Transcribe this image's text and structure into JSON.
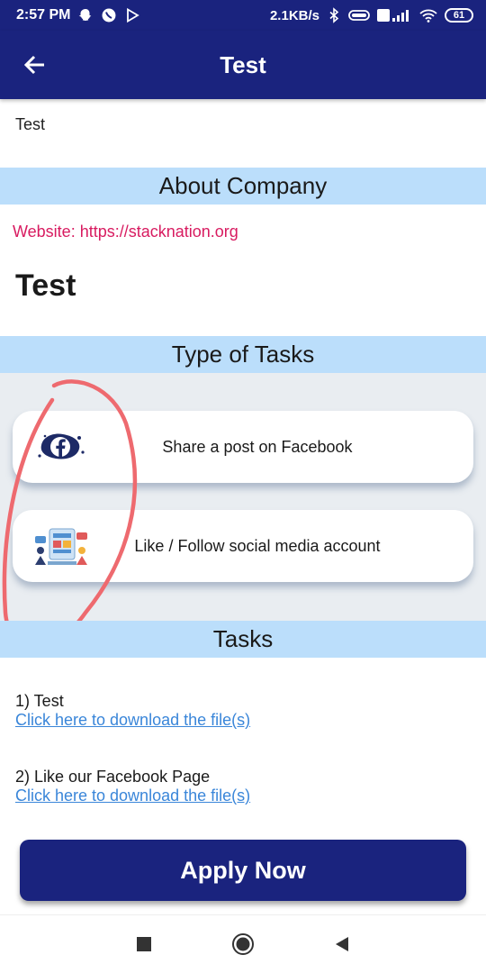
{
  "status_bar": {
    "time": "2:57 PM",
    "network_speed": "2.1KB/s",
    "battery": "61",
    "icons": [
      "snapchat-icon",
      "whatsapp-icon",
      "play-icon",
      "bluetooth-icon",
      "data-icon",
      "signal-icon",
      "wifi-icon",
      "battery-icon"
    ]
  },
  "app_bar": {
    "title": "Test",
    "back_icon": "arrow-left-icon"
  },
  "intro_text": "Test",
  "about": {
    "header": "About Company",
    "website_line": "Website: https://stacknation.org",
    "company_name": "Test"
  },
  "task_types": {
    "header": "Type of Tasks",
    "items": [
      {
        "label": "Share a post on Facebook",
        "icon": "facebook-share-icon"
      },
      {
        "label": "Like / Follow social media account",
        "icon": "social-media-icon"
      }
    ]
  },
  "tasks": {
    "header": "Tasks",
    "items": [
      {
        "title": "1) Test",
        "link": "Click here to download the file(s)"
      },
      {
        "title": "2) Like our Facebook Page",
        "link": "Click here to download the file(s)"
      }
    ]
  },
  "apply_button": "Apply Now",
  "colors": {
    "primary": "#1a237e",
    "section_header": "#bbdefb",
    "website_text": "#d81b60",
    "link": "#3a86d9",
    "annotation": "#ee6a6f"
  }
}
